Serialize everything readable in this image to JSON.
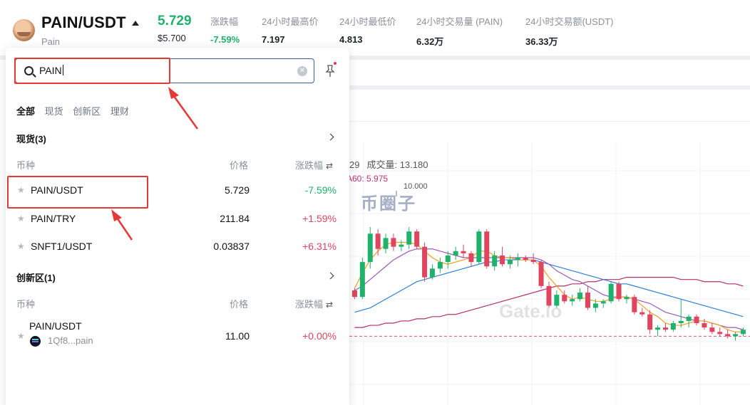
{
  "header": {
    "pair": "PAIN/USDT",
    "token_name": "Pain",
    "last_price": "5.729",
    "usd_price": "$5.700",
    "stats": [
      {
        "label": "涨跌幅",
        "value": "-7.59%",
        "tone": "green"
      },
      {
        "label": "24小时最高价",
        "value": "7.197",
        "tone": ""
      },
      {
        "label": "24小时最低价",
        "value": "4.813",
        "tone": ""
      },
      {
        "label": "24小时交易量 (PAIN)",
        "value": "6.32万",
        "tone": ""
      },
      {
        "label": "24小时交易额(USDT)",
        "value": "36.33万",
        "tone": ""
      }
    ]
  },
  "search": {
    "value": "PAIN",
    "clear_icon": "clear-circle-icon",
    "pin_icon": "pin-icon"
  },
  "tabs": [
    "全部",
    "现货",
    "创新区",
    "理财"
  ],
  "sections": [
    {
      "title": "现货(3)",
      "col_pair": "币种",
      "col_price": "价格",
      "col_change": "涨跌幅",
      "rows": [
        {
          "pair": "PAIN/USDT",
          "price": "5.729",
          "change": "-7.59%",
          "dir": "down"
        },
        {
          "pair": "PAIN/TRY",
          "price": "211.84",
          "change": "+1.59%",
          "dir": "up"
        },
        {
          "pair": "SNFT1/USDT",
          "price": "0.03837",
          "change": "+6.31%",
          "dir": "up"
        }
      ]
    },
    {
      "title": "创新区(1)",
      "col_pair": "币种",
      "col_price": "价格",
      "col_change": "涨跌幅",
      "rows": [
        {
          "pair": "PAIN/USDT",
          "sub": "1Qf8...pain",
          "price": "11.00",
          "change": "+0.00%",
          "dir": "up"
        }
      ]
    }
  ],
  "chart": {
    "volume_label": "成交量: 13.180",
    "volume_prefix": "29",
    "ma60_label": "A60: 5.975",
    "high_label": "10.000",
    "watermark_cn": "币圈子",
    "watermark_logo": "Gate.io",
    "colors": {
      "up": "#e0455f",
      "down": "#20b26c",
      "ma5": "#f0a020",
      "ma10": "#9b59b6",
      "ma30": "#2d7fd3",
      "ma60": "#b03068"
    }
  },
  "chart_data": {
    "type": "candlestick",
    "ohlc": [
      [
        6.0,
        6.1,
        5.6,
        5.7
      ],
      [
        5.7,
        7.5,
        5.6,
        7.3
      ],
      [
        7.3,
        8.9,
        7.0,
        8.6
      ],
      [
        8.6,
        8.8,
        7.6,
        7.9
      ],
      [
        7.9,
        8.6,
        7.7,
        8.4
      ],
      [
        8.4,
        8.6,
        7.8,
        8.0
      ],
      [
        8.0,
        8.3,
        7.8,
        8.1
      ],
      [
        8.1,
        8.9,
        7.9,
        8.7
      ],
      [
        8.7,
        8.8,
        7.9,
        8.0
      ],
      [
        8.0,
        8.2,
        6.4,
        6.6
      ],
      [
        6.6,
        7.2,
        6.5,
        7.0
      ],
      [
        7.0,
        7.5,
        6.8,
        7.3
      ],
      [
        7.3,
        7.8,
        7.0,
        7.6
      ],
      [
        7.6,
        8.0,
        7.4,
        7.8
      ],
      [
        7.8,
        8.1,
        7.5,
        7.7
      ],
      [
        7.7,
        7.8,
        7.1,
        7.3
      ],
      [
        7.3,
        8.8,
        7.2,
        8.7
      ],
      [
        8.7,
        8.8,
        7.0,
        7.1
      ],
      [
        7.1,
        7.8,
        6.9,
        7.6
      ],
      [
        7.6,
        8.0,
        7.1,
        7.2
      ],
      [
        7.2,
        7.6,
        7.0,
        7.4
      ],
      [
        7.4,
        7.7,
        7.1,
        7.5
      ],
      [
        7.5,
        7.6,
        7.3,
        7.4
      ],
      [
        7.4,
        7.7,
        7.2,
        7.3
      ],
      [
        7.3,
        7.4,
        6.1,
        6.2
      ],
      [
        6.2,
        6.4,
        5.2,
        5.3
      ],
      [
        5.3,
        6.0,
        5.2,
        5.8
      ],
      [
        5.8,
        6.0,
        5.4,
        5.5
      ],
      [
        5.5,
        5.8,
        5.3,
        5.6
      ],
      [
        5.6,
        6.1,
        5.5,
        5.9
      ],
      [
        5.9,
        6.2,
        5.1,
        5.2
      ],
      [
        5.2,
        5.6,
        5.0,
        5.4
      ],
      [
        5.4,
        5.6,
        5.2,
        5.5
      ],
      [
        5.5,
        6.4,
        5.4,
        6.3
      ],
      [
        6.3,
        6.4,
        5.5,
        5.6
      ],
      [
        5.6,
        5.8,
        5.4,
        5.7
      ],
      [
        5.7,
        5.8,
        4.9,
        5.0
      ],
      [
        5.0,
        5.2,
        4.8,
        4.9
      ],
      [
        4.9,
        5.1,
        4.0,
        4.2
      ],
      [
        4.2,
        4.4,
        3.9,
        4.3
      ],
      [
        4.3,
        4.5,
        4.1,
        4.2
      ],
      [
        4.2,
        4.6,
        4.1,
        4.5
      ],
      [
        4.5,
        5.6,
        4.3,
        4.6
      ],
      [
        4.6,
        4.9,
        4.3,
        4.8
      ],
      [
        4.8,
        4.9,
        4.4,
        4.5
      ],
      [
        4.5,
        4.7,
        4.2,
        4.3
      ],
      [
        4.3,
        4.5,
        4.0,
        4.1
      ],
      [
        4.1,
        4.3,
        3.9,
        4.0
      ],
      [
        4.0,
        4.2,
        3.8,
        3.9
      ],
      [
        3.9,
        4.1,
        3.7,
        4.0
      ],
      [
        4.0,
        4.3,
        3.9,
        4.2
      ]
    ],
    "ma5": [
      6.1,
      6.8,
      7.4,
      7.8,
      8.1,
      8.2,
      8.2,
      8.2,
      8.1,
      7.8,
      7.5,
      7.3,
      7.2,
      7.3,
      7.4,
      7.5,
      7.8,
      7.8,
      7.6,
      7.5,
      7.5,
      7.4,
      7.4,
      7.4,
      7.1,
      6.6,
      6.2,
      5.8,
      5.6,
      5.7,
      5.6,
      5.5,
      5.5,
      5.6,
      5.7,
      5.7,
      5.6,
      5.3,
      5.0,
      4.8,
      4.5,
      4.4,
      4.4,
      4.5,
      4.6,
      4.6,
      4.5,
      4.4,
      4.2,
      4.1,
      4.1
    ],
    "ma10": [
      6.0,
      6.2,
      6.5,
      6.8,
      7.1,
      7.4,
      7.6,
      7.8,
      7.9,
      7.9,
      7.9,
      7.8,
      7.7,
      7.6,
      7.5,
      7.5,
      7.5,
      7.5,
      7.5,
      7.5,
      7.5,
      7.5,
      7.5,
      7.5,
      7.4,
      7.2,
      6.9,
      6.7,
      6.5,
      6.4,
      6.2,
      6.0,
      5.8,
      5.7,
      5.7,
      5.7,
      5.6,
      5.5,
      5.4,
      5.2,
      5.0,
      4.9,
      4.8,
      4.7,
      4.6,
      4.6,
      4.5,
      4.4,
      4.3,
      4.3,
      4.2
    ],
    "ma30": [
      5.0,
      5.1,
      5.2,
      5.4,
      5.6,
      5.8,
      6.0,
      6.2,
      6.4,
      6.5,
      6.6,
      6.7,
      6.8,
      6.9,
      7.0,
      7.1,
      7.2,
      7.3,
      7.3,
      7.4,
      7.4,
      7.4,
      7.4,
      7.4,
      7.3,
      7.2,
      7.1,
      7.0,
      6.9,
      6.8,
      6.7,
      6.6,
      6.5,
      6.4,
      6.3,
      6.3,
      6.2,
      6.1,
      6.0,
      5.9,
      5.8,
      5.7,
      5.6,
      5.5,
      5.4,
      5.3,
      5.2,
      5.1,
      5.0,
      4.9,
      4.8
    ],
    "ma60": [
      4.3,
      4.3,
      4.4,
      4.4,
      4.5,
      4.5,
      4.6,
      4.6,
      4.7,
      4.7,
      4.8,
      4.8,
      4.9,
      4.9,
      5.0,
      5.1,
      5.2,
      5.3,
      5.4,
      5.5,
      5.6,
      5.7,
      5.8,
      5.9,
      6.0,
      6.1,
      6.2,
      6.2,
      6.3,
      6.3,
      6.4,
      6.4,
      6.5,
      6.5,
      6.5,
      6.6,
      6.6,
      6.6,
      6.6,
      6.6,
      6.6,
      6.6,
      6.5,
      6.5,
      6.5,
      6.4,
      6.4,
      6.4,
      6.3,
      6.3,
      6.2
    ],
    "ylim": [
      3.0,
      10.5
    ],
    "dashed_level": 3.9
  }
}
